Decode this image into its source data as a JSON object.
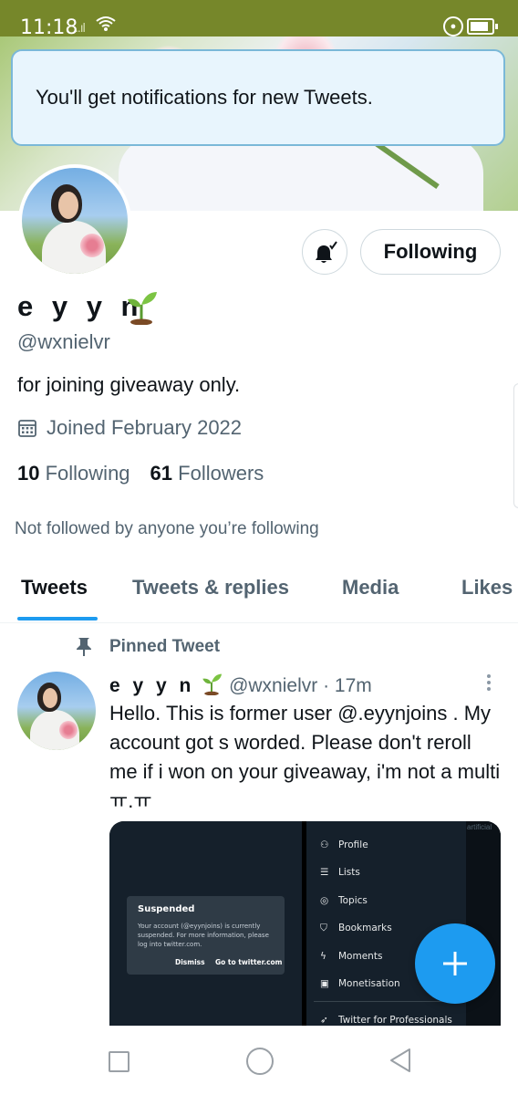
{
  "status_bar": {
    "time": "11:18",
    "signal": "..ıl",
    "battery_level": 0.85
  },
  "toast": {
    "message": "You'll get notifications for new Tweets."
  },
  "profile": {
    "display_name": "e y y n",
    "name_emoji": "seedling-emoji",
    "handle": "@wxnielvr",
    "bio": "for joining giveaway only.",
    "joined": "Joined February 2022",
    "following_count": "10",
    "following_label": "Following",
    "followers_count": "61",
    "followers_label": "Followers",
    "not_followed_note": "Not followed by anyone you’re following",
    "follow_button_label": "Following",
    "bell_icon": "bell-checked-icon"
  },
  "tabs": [
    {
      "label": "Tweets",
      "active": true
    },
    {
      "label": "Tweets & replies",
      "active": false
    },
    {
      "label": "Media",
      "active": false
    },
    {
      "label": "Likes",
      "active": false
    }
  ],
  "pinned_tweet": {
    "pinned_label": "Pinned Tweet",
    "author_name": "e y y n",
    "handle": "@wxnielvr",
    "time": "· 17m",
    "text": "Hello. This is former user @.eyynjoins . My account got s worded. Please don't reroll me if i won on your giveaway, i'm not a multi ㅠ.ㅠ",
    "media": {
      "dialog_title": "Suspended",
      "dialog_body": "Your account (@eyynjoins) is currently suspended. For more information, please log into twitter.com.",
      "dialog_dismiss": "Dismiss",
      "dialog_goto": "Go to twitter.com",
      "menu_items": [
        "Profile",
        "Lists",
        "Topics",
        "Bookmarks",
        "Moments",
        "Monetisation",
        "Twitter for Professionals"
      ],
      "edge_text": "artificial"
    }
  },
  "colors": {
    "accent": "#1d9bf0",
    "status_bar": "#76872a",
    "secondary_text": "#536471",
    "toast_bg": "#e8f5fd",
    "toast_border": "#7ab8d8"
  }
}
